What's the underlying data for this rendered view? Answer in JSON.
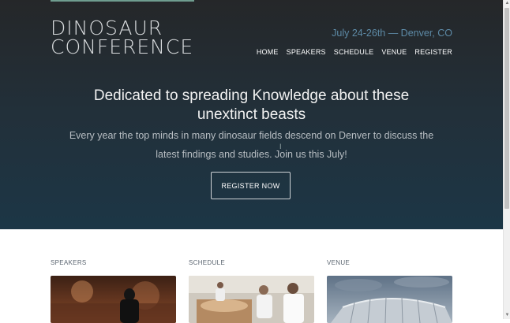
{
  "header": {
    "logo_line1": "DINOSAUR",
    "logo_line2": "CONFERENCE",
    "dates": "July 24-26th — Denver, CO",
    "nav": [
      "HOME",
      "SPEAKERS",
      "SCHEDULE",
      "VENUE",
      "REGISTER"
    ]
  },
  "hero": {
    "headline": "Dedicated to spreading Knowledge about these unextinct beasts",
    "subtext": "Every year the top minds in many dinosaur fields descend on Denver to discuss the latest findings and studies. Join us this July!",
    "button_label": "REGISTER NOW"
  },
  "sections": [
    {
      "label": "SPEAKERS"
    },
    {
      "label": "SCHEDULE"
    },
    {
      "label": "VENUE"
    }
  ],
  "colors": {
    "accent": "#6f9d8f",
    "dates": "#5d8aa6",
    "hero_top": "#252729",
    "hero_bottom": "#1c3646"
  },
  "icons": {
    "scroll_up": "scroll-up-arrow-icon",
    "scroll_down": "scroll-down-arrow-icon"
  }
}
